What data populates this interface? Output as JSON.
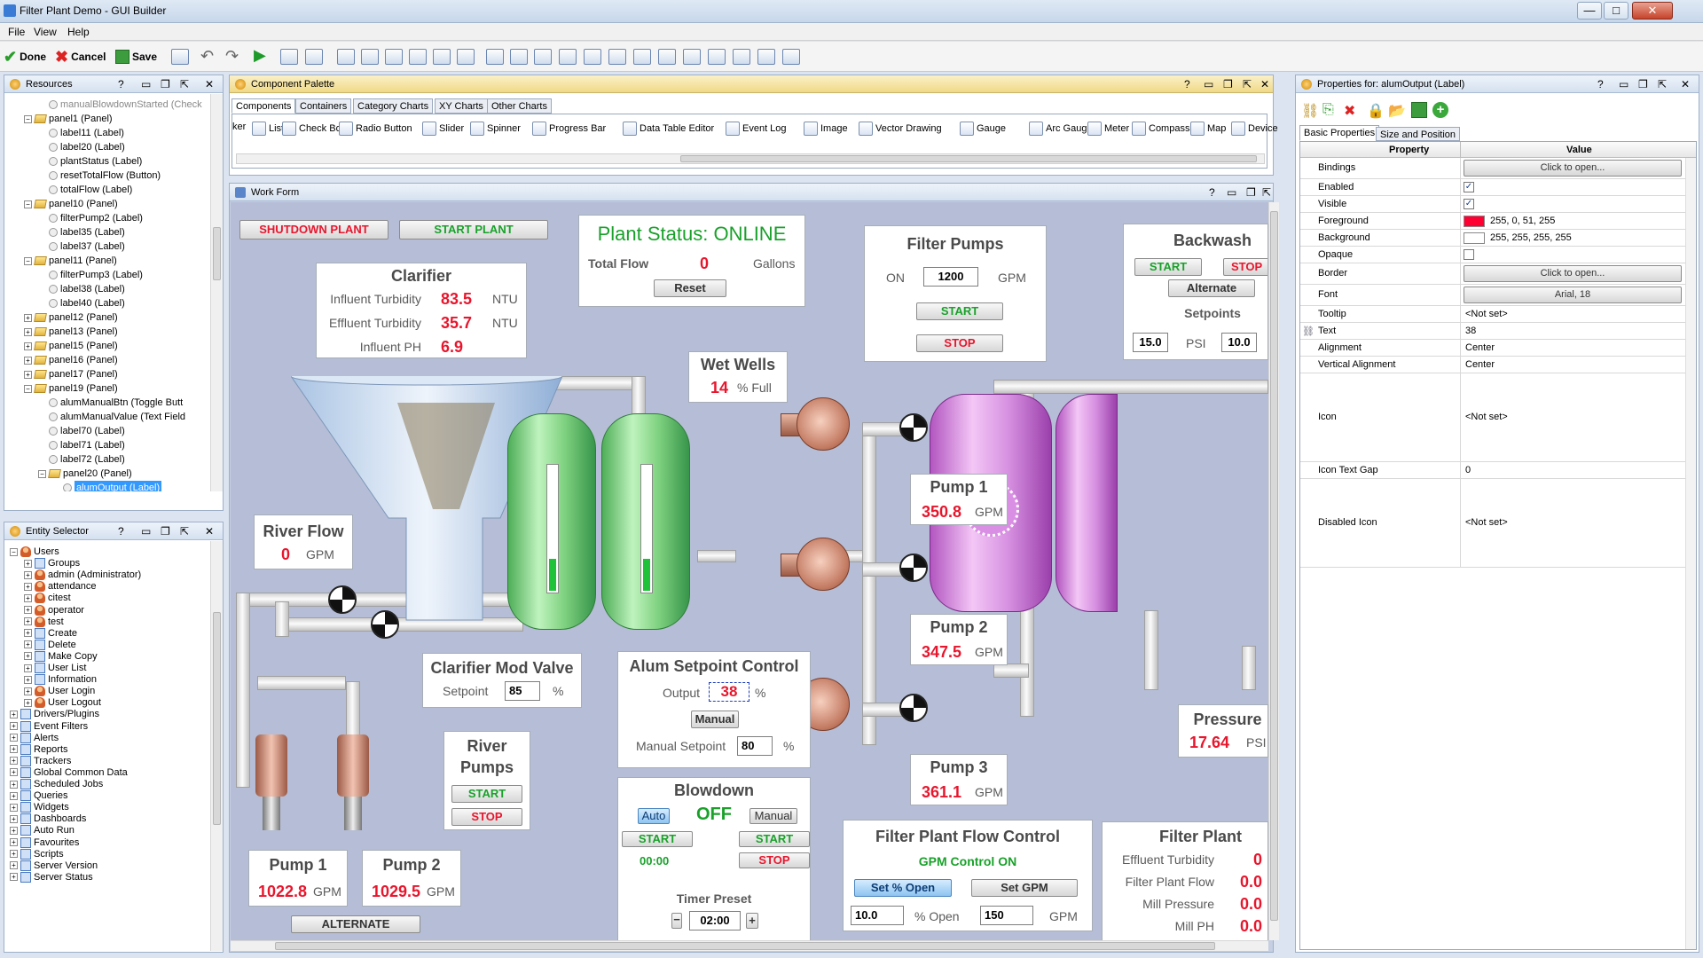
{
  "window": {
    "title": "Filter Plant Demo - GUI Builder",
    "min": "—",
    "max": "□",
    "close": "✕"
  },
  "menu": [
    "File",
    "View",
    "Help"
  ],
  "toolbar": {
    "done": "Done",
    "cancel": "Cancel",
    "save": "Save"
  },
  "resources": {
    "title": "Resources",
    "items": [
      {
        "t": "manualBlowdownStarted  (Check",
        "lv": 3,
        "k": "lbl",
        "dim": true
      },
      {
        "t": "panel1  (Panel)",
        "lv": 2,
        "k": "fold"
      },
      {
        "t": "label11  (Label)",
        "lv": 3,
        "k": "lbl"
      },
      {
        "t": "label20  (Label)",
        "lv": 3,
        "k": "lbl"
      },
      {
        "t": "plantStatus  (Label)",
        "lv": 3,
        "k": "lbl"
      },
      {
        "t": "resetTotalFlow  (Button)",
        "lv": 3,
        "k": "lbl"
      },
      {
        "t": "totalFlow  (Label)",
        "lv": 3,
        "k": "lbl"
      },
      {
        "t": "panel10  (Panel)",
        "lv": 2,
        "k": "fold"
      },
      {
        "t": "filterPump2  (Label)",
        "lv": 3,
        "k": "lbl"
      },
      {
        "t": "label35  (Label)",
        "lv": 3,
        "k": "lbl"
      },
      {
        "t": "label37  (Label)",
        "lv": 3,
        "k": "lbl"
      },
      {
        "t": "panel11  (Panel)",
        "lv": 2,
        "k": "fold"
      },
      {
        "t": "filterPump3  (Label)",
        "lv": 3,
        "k": "lbl"
      },
      {
        "t": "label38  (Label)",
        "lv": 3,
        "k": "lbl"
      },
      {
        "t": "label40  (Label)",
        "lv": 3,
        "k": "lbl"
      },
      {
        "t": "panel12  (Panel)",
        "lv": 2,
        "k": "fold",
        "c": true
      },
      {
        "t": "panel13  (Panel)",
        "lv": 2,
        "k": "fold",
        "c": true
      },
      {
        "t": "panel15  (Panel)",
        "lv": 2,
        "k": "fold",
        "c": true
      },
      {
        "t": "panel16  (Panel)",
        "lv": 2,
        "k": "fold",
        "c": true
      },
      {
        "t": "panel17  (Panel)",
        "lv": 2,
        "k": "fold",
        "c": true
      },
      {
        "t": "panel19  (Panel)",
        "lv": 2,
        "k": "fold"
      },
      {
        "t": "alumManualBtn  (Toggle Butt",
        "lv": 3,
        "k": "lbl"
      },
      {
        "t": "alumManualValue  (Text Field",
        "lv": 3,
        "k": "lbl"
      },
      {
        "t": "label70  (Label)",
        "lv": 3,
        "k": "lbl"
      },
      {
        "t": "label71  (Label)",
        "lv": 3,
        "k": "lbl"
      },
      {
        "t": "label72  (Label)",
        "lv": 3,
        "k": "lbl"
      },
      {
        "t": "panel20  (Panel)",
        "lv": 3,
        "k": "fold"
      },
      {
        "t": "alumOutput  (Label)",
        "lv": 4,
        "k": "lbl",
        "sel": true
      }
    ]
  },
  "entity": {
    "title": "Entity Selector",
    "items": [
      {
        "t": "Users",
        "lv": 1,
        "k": "u"
      },
      {
        "t": "Groups",
        "lv": 2,
        "k": "g"
      },
      {
        "t": "admin (Administrator)",
        "lv": 2,
        "k": "u"
      },
      {
        "t": "attendance",
        "lv": 2,
        "k": "u"
      },
      {
        "t": "citest",
        "lv": 2,
        "k": "u"
      },
      {
        "t": "operator",
        "lv": 2,
        "k": "u"
      },
      {
        "t": "test",
        "lv": 2,
        "k": "u"
      },
      {
        "t": "Create",
        "lv": 2,
        "k": "g"
      },
      {
        "t": "Delete",
        "lv": 2,
        "k": "g"
      },
      {
        "t": "Make Copy",
        "lv": 2,
        "k": "g"
      },
      {
        "t": "User List",
        "lv": 2,
        "k": "g"
      },
      {
        "t": "Information",
        "lv": 2,
        "k": "g"
      },
      {
        "t": "User Login",
        "lv": 2,
        "k": "u"
      },
      {
        "t": "User Logout",
        "lv": 2,
        "k": "u"
      },
      {
        "t": "Drivers/Plugins",
        "lv": 1,
        "k": "g"
      },
      {
        "t": "Event Filters",
        "lv": 1,
        "k": "g"
      },
      {
        "t": "Alerts",
        "lv": 1,
        "k": "g"
      },
      {
        "t": "Reports",
        "lv": 1,
        "k": "g"
      },
      {
        "t": "Trackers",
        "lv": 1,
        "k": "g"
      },
      {
        "t": "Global Common Data",
        "lv": 1,
        "k": "g"
      },
      {
        "t": "Scheduled Jobs",
        "lv": 1,
        "k": "g"
      },
      {
        "t": "Queries",
        "lv": 1,
        "k": "g"
      },
      {
        "t": "Widgets",
        "lv": 1,
        "k": "g"
      },
      {
        "t": "Dashboards",
        "lv": 1,
        "k": "g"
      },
      {
        "t": "Auto Run",
        "lv": 1,
        "k": "g"
      },
      {
        "t": "Favourites",
        "lv": 1,
        "k": "g"
      },
      {
        "t": "Scripts",
        "lv": 1,
        "k": "g"
      },
      {
        "t": "Server Version",
        "lv": 1,
        "k": "g"
      },
      {
        "t": "Server Status",
        "lv": 1,
        "k": "g"
      }
    ]
  },
  "palette": {
    "title": "Component Palette",
    "tabs": [
      "Components",
      "Containers",
      "Category Charts",
      "XY Charts",
      "Other Charts"
    ],
    "items": [
      "ker",
      "List",
      "Check Box",
      "Radio Button",
      "Slider",
      "Spinner",
      "Progress Bar",
      "Data Table Editor",
      "Event Log",
      "Image",
      "Vector Drawing",
      "Gauge",
      "Arc Gauge",
      "Meter",
      "Compass",
      "Map",
      "Device"
    ]
  },
  "work": {
    "title": "Work Form",
    "shutdown": "SHUTDOWN PLANT",
    "startPlant": "START PLANT",
    "status": {
      "title": "Plant Status: ONLINE",
      "totalFlow": "Total Flow",
      "value": "0",
      "unit": "Gallons",
      "reset": "Reset"
    },
    "clarifier": {
      "title": "Clarifier",
      "rows": [
        [
          "Influent Turbidity",
          "83.5",
          "NTU"
        ],
        [
          "Effluent Turbidity",
          "35.7",
          "NTU"
        ],
        [
          "Influent PH",
          "6.9",
          ""
        ]
      ]
    },
    "wetwells": {
      "title": "Wet Wells",
      "value": "14",
      "unit": "% Full",
      "levels": [
        0.25,
        0.25
      ]
    },
    "filterPumps": {
      "title": "Filter Pumps",
      "on": "ON",
      "value": "1200",
      "unit": "GPM",
      "start": "START",
      "stop": "STOP"
    },
    "backwash": {
      "title": "Backwash",
      "start": "START",
      "stop": "STOP",
      "alternate": "Alternate",
      "setpoints": "Setpoints",
      "low": "15.0",
      "psi": "PSI",
      "high": "10.0"
    },
    "riverFlow": {
      "title": "River Flow",
      "value": "0",
      "unit": "GPM"
    },
    "pump1": {
      "title": "Pump 1",
      "value": "350.8",
      "unit": "GPM"
    },
    "pump2": {
      "title": "Pump 2",
      "value": "347.5",
      "unit": "GPM"
    },
    "pump3": {
      "title": "Pump 3",
      "value": "361.1",
      "unit": "GPM"
    },
    "clarValve": {
      "title": "Clarifier Mod Valve",
      "label": "Setpoint",
      "value": "85",
      "unit": "%"
    },
    "alum": {
      "title": "Alum Setpoint Control",
      "output": "Output",
      "outVal": "38",
      "pct": "%",
      "manual": "Manual",
      "msLabel": "Manual Setpoint",
      "msVal": "80"
    },
    "riverPumps": {
      "t1": "River",
      "t2": "Pumps",
      "start": "START",
      "stop": "STOP"
    },
    "pressure": {
      "title": "Pressure",
      "value": "17.64",
      "unit": "PSI"
    },
    "blowdown": {
      "title": "Blowdown",
      "auto": "Auto",
      "state": "OFF",
      "manual": "Manual",
      "start1": "START",
      "start2": "START",
      "time": "00:00",
      "stop": "STOP",
      "preset": "Timer Preset",
      "presetVal": "02:00"
    },
    "rpump1": {
      "title": "Pump 1",
      "value": "1022.8",
      "unit": "GPM"
    },
    "rpump2": {
      "title": "Pump 2",
      "value": "1029.5",
      "unit": "GPM"
    },
    "alternate": "ALTERNATE",
    "fpfc": {
      "title": "Filter Plant Flow Control",
      "state": "GPM Control ON",
      "setOpen": "Set % Open",
      "setGpm": "Set GPM",
      "openVal": "10.0",
      "openUnit": "% Open",
      "gpmVal": "150",
      "gpmUnit": "GPM"
    },
    "filterPlant": {
      "title": "Filter Plant",
      "rows": [
        [
          "Effluent Turbidity",
          "0"
        ],
        [
          "Filter Plant Flow",
          "0.0"
        ],
        [
          "Mill Pressure",
          "0.0"
        ],
        [
          "Mill PH",
          "0.0"
        ]
      ]
    }
  },
  "props": {
    "title": "Properties for: alumOutput (Label)",
    "tabs": [
      "Basic Properties",
      "Size and Position"
    ],
    "headers": [
      "Property",
      "Value"
    ],
    "rows": [
      {
        "p": "Bindings",
        "v": "Click to open...",
        "btn": true
      },
      {
        "p": "Enabled",
        "v": "✓",
        "chk": true
      },
      {
        "p": "Visible",
        "v": "✓",
        "chk": true
      },
      {
        "p": "Foreground",
        "v": "255, 0, 51, 255",
        "sw": "#ff0033"
      },
      {
        "p": "Background",
        "v": "255, 255, 255, 255",
        "sw": "#ffffff"
      },
      {
        "p": "Opaque",
        "v": "",
        "chk": true
      },
      {
        "p": "Border",
        "v": "Click to open...",
        "btn": true
      },
      {
        "p": "Font",
        "v": "Arial, 18",
        "btn": true
      },
      {
        "p": "Tooltip",
        "v": "<Not set>"
      },
      {
        "p": "Text",
        "v": "38"
      },
      {
        "p": "Alignment",
        "v": "Center"
      },
      {
        "p": "Vertical Alignment",
        "v": "Center"
      },
      {
        "p": "Icon",
        "v": "<Not set>"
      },
      {
        "p": "Icon Text Gap",
        "v": "0"
      },
      {
        "p": "Disabled Icon",
        "v": "<Not set>"
      }
    ]
  }
}
